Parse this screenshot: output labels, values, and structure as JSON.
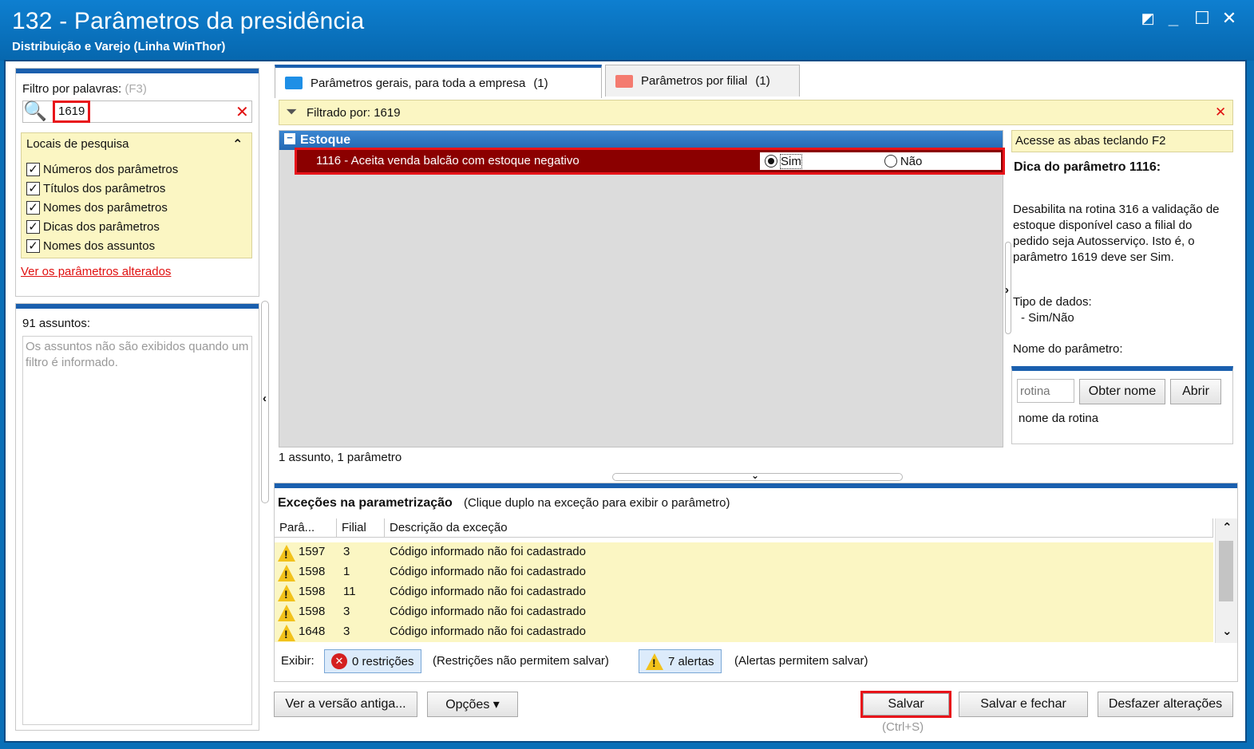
{
  "window": {
    "title": "132 - Parâmetros da presidência",
    "subtitle": "Distribuição e Varejo (Linha WinThor)"
  },
  "filter": {
    "label": "Filtro por palavras:",
    "shortcut": "(F3)",
    "value": "1619",
    "locais_title": "Locais de pesquisa",
    "options": [
      "Números dos parâmetros",
      "Títulos dos parâmetros",
      "Nomes dos parâmetros",
      "Dicas dos parâmetros",
      "Nomes dos assuntos"
    ],
    "changed_link": "Ver os parâmetros alterados"
  },
  "subjects": {
    "count": "91 assuntos:",
    "message": "Os assuntos não são exibidos quando um filtro é informado."
  },
  "tabs": [
    {
      "label": "Parâmetros gerais, para toda a empresa",
      "count": "(1)"
    },
    {
      "label": "Parâmetros por filial",
      "count": "(1)"
    }
  ],
  "filtered_by": "Filtrado por: 1619",
  "group": "Estoque",
  "param": {
    "label": "1116 - Aceita venda balcão com estoque negativo",
    "yes": "Sim",
    "no": "Não"
  },
  "summary": "1 assunto, 1 parâmetro",
  "hint": {
    "access": "Acesse as abas teclando F2",
    "title": "Dica do parâmetro 1116:",
    "text": "Desabilita na rotina 316 a validação de estoque disponível caso a filial do pedido seja Autosserviço. Isto é, o parâmetro 1619 deve ser Sim.",
    "type_label": "Tipo de dados:",
    "type_value": "- Sim/Não",
    "name_label": "Nome do parâmetro:",
    "routine_placeholder": "rotina",
    "get_name": "Obter nome",
    "open": "Abrir",
    "routine_name": "nome da rotina"
  },
  "exceptions": {
    "title": "Exceções na parametrização",
    "subtitle": "(Clique duplo na exceção para exibir o parâmetro)",
    "headers": [
      "Parâ...",
      "Filial",
      "Descrição da exceção"
    ],
    "rows": [
      {
        "param": "1597",
        "filial": "3",
        "desc": "Código informado não foi cadastrado"
      },
      {
        "param": "1598",
        "filial": "1",
        "desc": "Código informado não foi cadastrado"
      },
      {
        "param": "1598",
        "filial": "11",
        "desc": "Código informado não foi cadastrado"
      },
      {
        "param": "1598",
        "filial": "3",
        "desc": "Código informado não foi cadastrado"
      },
      {
        "param": "1648",
        "filial": "3",
        "desc": "Código informado não foi cadastrado"
      }
    ],
    "show_label": "Exibir:",
    "restrictions": "0 restrições",
    "restrictions_note": "(Restrições não permitem salvar)",
    "alerts": "7 alertas",
    "alerts_note": "(Alertas permitem salvar)"
  },
  "buttons": {
    "old_version": "Ver a versão antiga...",
    "options": "Opções ▾",
    "save": "Salvar",
    "save_shortcut": "(Ctrl+S)",
    "save_close": "Salvar e fechar",
    "undo": "Desfazer alterações"
  },
  "colors": {
    "titlebar": "#0a6fb7",
    "highlight_row": "#8b0000",
    "annotation": "#e8141a",
    "note_bg": "#fbf6c3"
  }
}
